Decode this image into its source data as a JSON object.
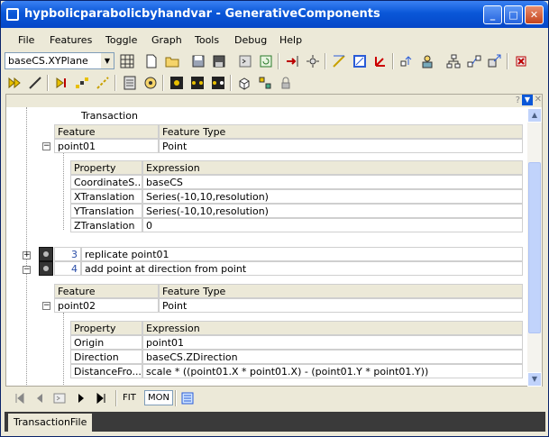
{
  "window": {
    "title": "hypbolicparabolicbyhandvar - GenerativeComponents"
  },
  "menu": [
    "File",
    "Features",
    "Toggle",
    "Graph",
    "Tools",
    "Debug",
    "Help"
  ],
  "toolbar": {
    "cs_select": "baseCS.XYPlane"
  },
  "panel": {
    "column": "Transaction"
  },
  "group1": {
    "feature_hdr": "Feature",
    "type_hdr": "Feature Type",
    "feature": "point01",
    "type": "Point",
    "prop_hdr": "Property",
    "expr_hdr": "Expression",
    "rows": [
      {
        "p": "CoordinateS...",
        "e": "baseCS"
      },
      {
        "p": "XTranslation",
        "e": "Series(-10,10,resolution)"
      },
      {
        "p": "YTranslation",
        "e": "Series(-10,10,resolution)"
      },
      {
        "p": "ZTranslation",
        "e": "0"
      }
    ]
  },
  "steps": [
    {
      "num": "3",
      "label": "replicate point01"
    },
    {
      "num": "4",
      "label": "add point at direction from point"
    }
  ],
  "group2": {
    "feature_hdr": "Feature",
    "type_hdr": "Feature Type",
    "feature": "point02",
    "type": "Point",
    "prop_hdr": "Property",
    "expr_hdr": "Expression",
    "rows": [
      {
        "p": "Origin",
        "e": "point01"
      },
      {
        "p": "Direction",
        "e": "baseCS.ZDirection"
      },
      {
        "p": "DistanceFro...",
        "e": "scale  * ((point01.X * point01.X) - (point01.Y * point01.Y))"
      }
    ]
  },
  "bottom": {
    "fit": "FIT",
    "mon": "MON"
  },
  "tabs": [
    "TransactionFile"
  ]
}
